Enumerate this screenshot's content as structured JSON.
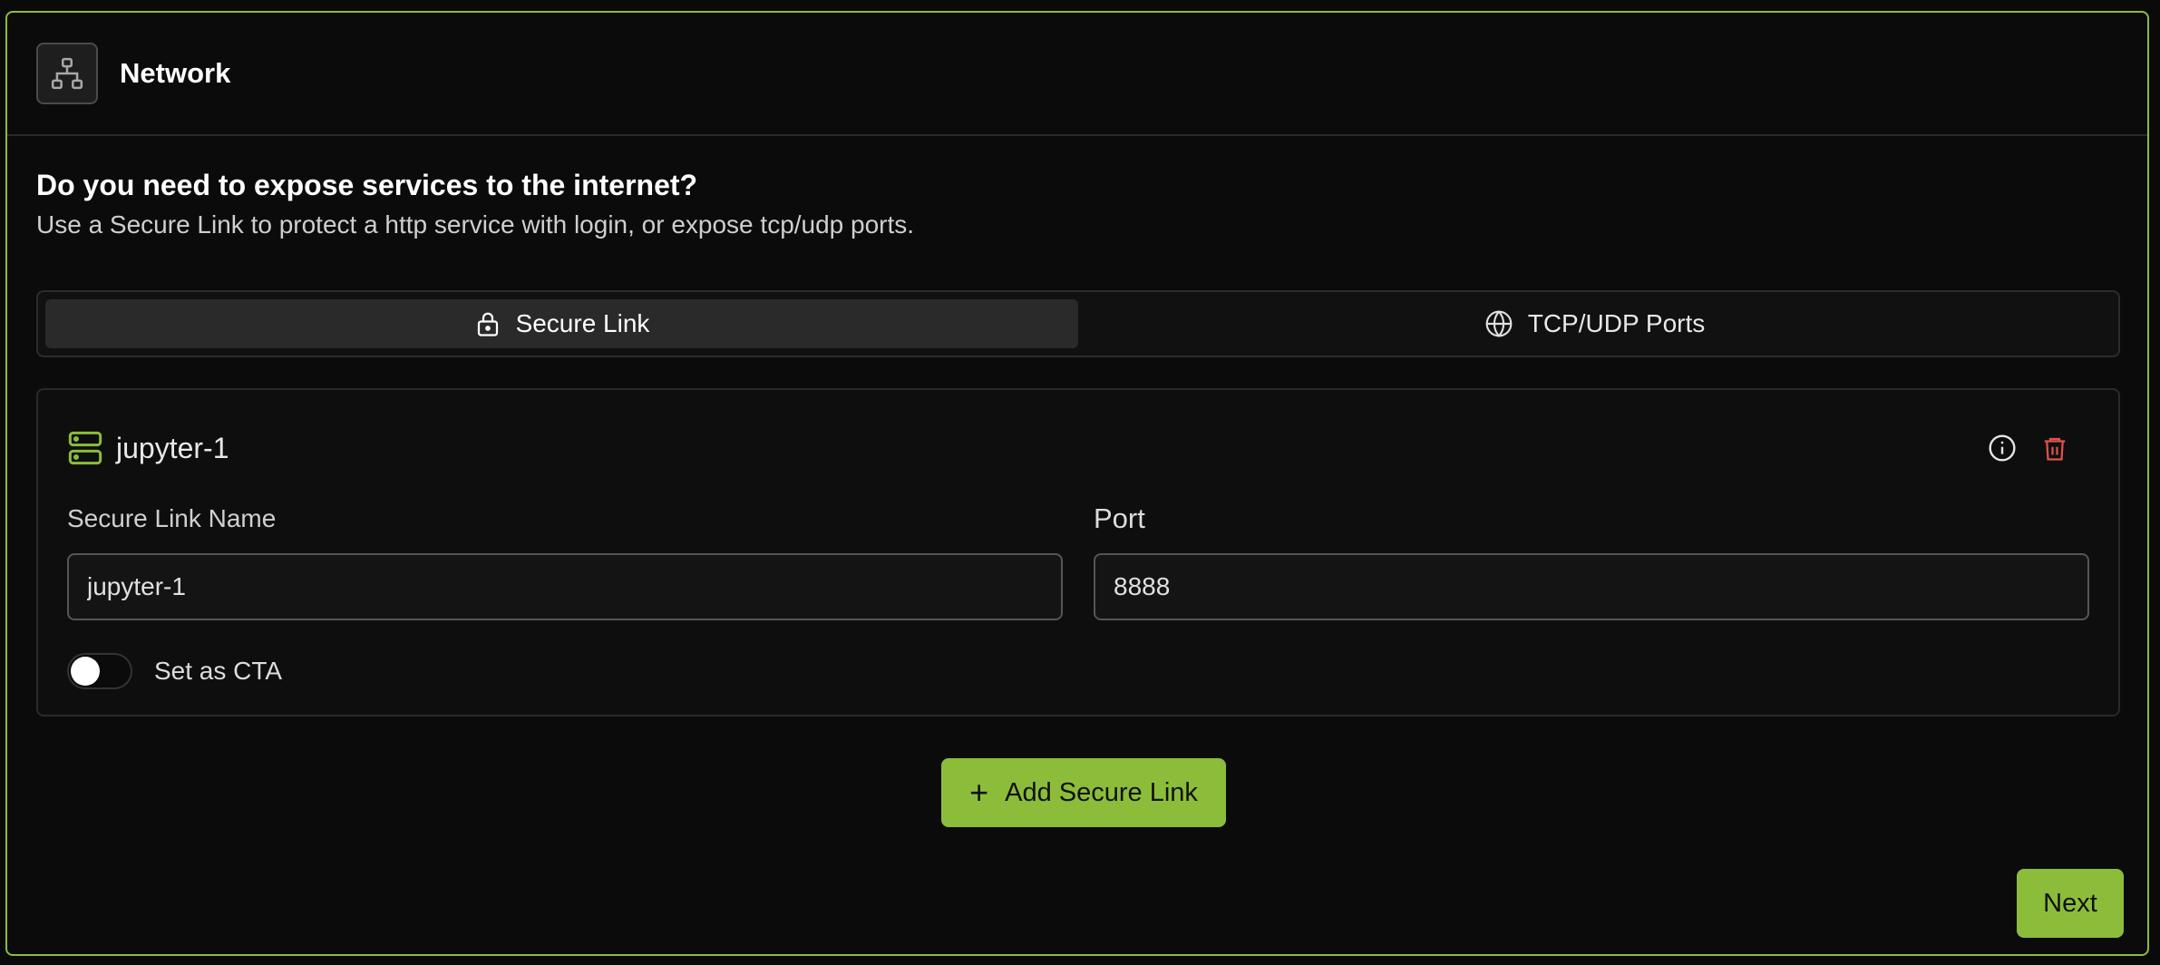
{
  "header": {
    "title": "Network",
    "icon": "network-icon"
  },
  "intro": {
    "question": "Do you need to expose services to the internet?",
    "description": "Use a Secure Link to protect a http service with login, or expose tcp/udp ports."
  },
  "tabs": [
    {
      "label": "Secure Link",
      "icon": "lock-icon",
      "active": true
    },
    {
      "label": "TCP/UDP Ports",
      "icon": "globe-icon",
      "active": false
    }
  ],
  "secure_link": {
    "title": "jupyter-1",
    "icon": "server-icon",
    "name_label": "Secure Link Name",
    "name_value": "jupyter-1",
    "port_label": "Port",
    "port_value": "8888",
    "cta_label": "Set as CTA",
    "cta_enabled": false
  },
  "actions": {
    "add_label": "Add Secure Link",
    "next_label": "Next"
  },
  "colors": {
    "accent": "#8cbd3a",
    "danger": "#e0524a"
  }
}
